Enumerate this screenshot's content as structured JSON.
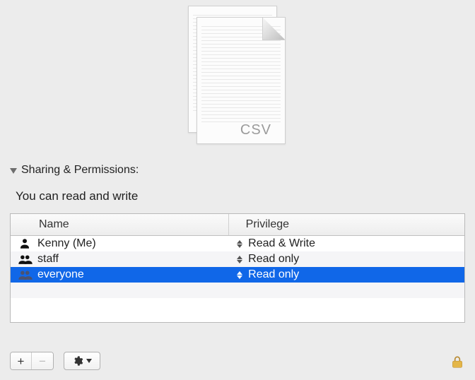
{
  "preview": {
    "extension_label": "CSV"
  },
  "section": {
    "title": "Sharing & Permissions:",
    "summary": "You can read and write",
    "columns": {
      "name": "Name",
      "privilege": "Privilege"
    },
    "rows": [
      {
        "icon": "person",
        "name": "Kenny (Me)",
        "privilege": "Read & Write",
        "selected": false
      },
      {
        "icon": "group",
        "name": "staff",
        "privilege": "Read only",
        "selected": false
      },
      {
        "icon": "group",
        "name": "everyone",
        "privilege": "Read only",
        "selected": true
      }
    ]
  },
  "footer": {
    "add_label": "+",
    "remove_label": "−"
  }
}
